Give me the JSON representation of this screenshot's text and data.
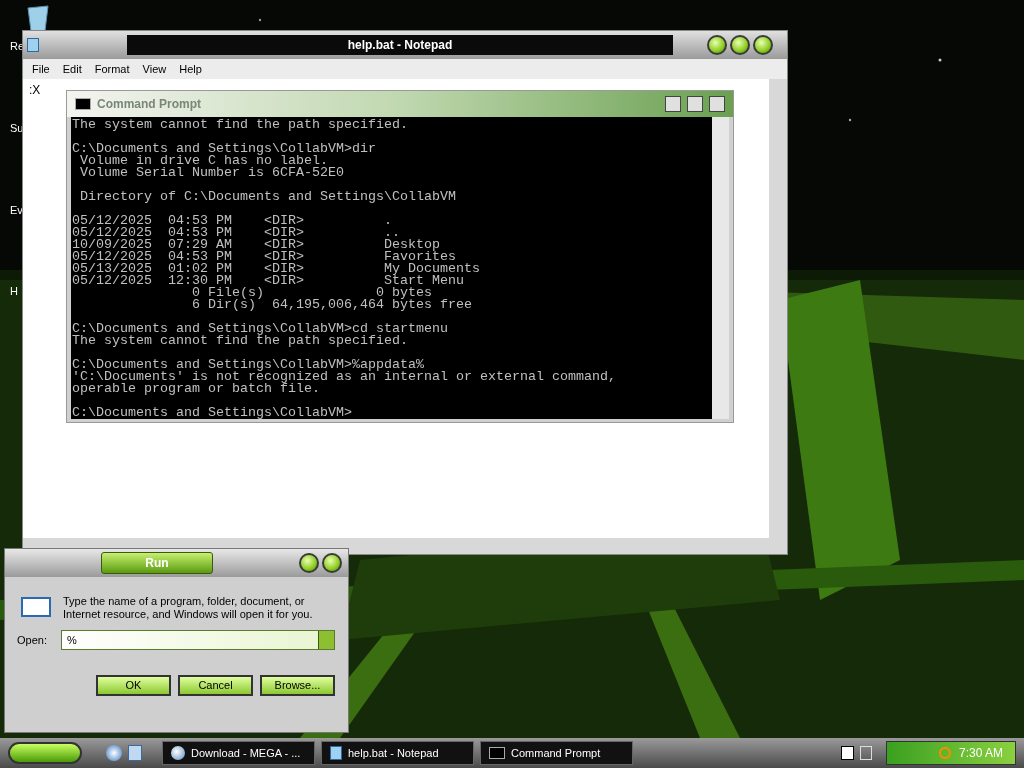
{
  "desktop": {
    "icons": [
      {
        "label": "Re",
        "kind": "recycle"
      },
      {
        "label": "Su",
        "kind": "hidden"
      },
      {
        "label": "Ev",
        "kind": "hidden"
      },
      {
        "label": "H",
        "kind": "hidden"
      }
    ]
  },
  "notepad": {
    "title": "help.bat - Notepad",
    "menu": [
      "File",
      "Edit",
      "Format",
      "View",
      "Help"
    ],
    "content": ":X"
  },
  "command_prompt": {
    "title": "Command Prompt",
    "active": false,
    "blocks": [
      [
        "The system cannot find the path specified."
      ],
      [
        "C:\\Documents and Settings\\CollabVM>dir",
        " Volume in drive C has no label.",
        " Volume Serial Number is 6CFA-52E0"
      ],
      [
        " Directory of C:\\Documents and Settings\\CollabVM"
      ],
      [
        "05/12/2025  04:53 PM    <DIR>          .",
        "05/12/2025  04:53 PM    <DIR>          ..",
        "10/09/2025  07:29 AM    <DIR>          Desktop",
        "05/12/2025  04:53 PM    <DIR>          Favorites",
        "05/13/2025  01:02 PM    <DIR>          My Documents",
        "05/12/2025  12:30 PM    <DIR>          Start Menu",
        "               0 File(s)              0 bytes",
        "               6 Dir(s)  64,195,006,464 bytes free"
      ],
      [
        "C:\\Documents and Settings\\CollabVM>cd startmenu",
        "The system cannot find the path specified."
      ],
      [
        "C:\\Documents and Settings\\CollabVM>%appdata%",
        "'C:\\Documents' is not recognized as an internal or external command,",
        "operable program or batch file."
      ],
      [
        "C:\\Documents and Settings\\CollabVM>"
      ]
    ]
  },
  "run": {
    "title": "Run",
    "description": "Type the name of a program, folder, document, or Internet resource, and Windows will open it for you.",
    "open_label": "Open:",
    "open_value": "%",
    "buttons": [
      "OK",
      "Cancel",
      "Browse..."
    ]
  },
  "taskbar": {
    "tasks": [
      {
        "label": "Download - MEGA - ...",
        "kind": "browser"
      },
      {
        "label": "help.bat - Notepad",
        "kind": "notepad"
      },
      {
        "label": "Command Prompt",
        "kind": "console"
      }
    ],
    "clock": "7:30 AM"
  }
}
